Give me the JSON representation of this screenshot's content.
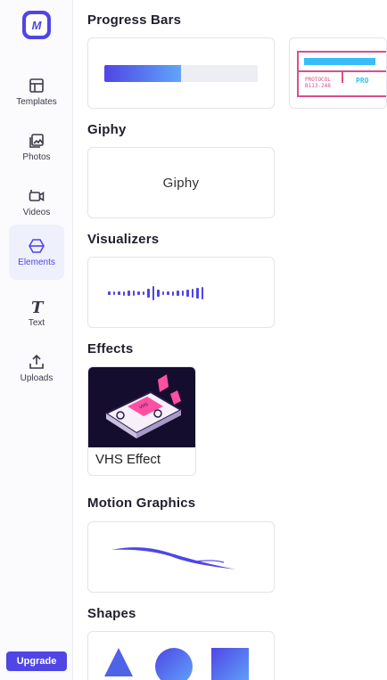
{
  "app": {
    "logo_letter": "M",
    "accent": "#4f46e5"
  },
  "sidebar": {
    "items": [
      {
        "label": "Templates",
        "icon": "templates-icon"
      },
      {
        "label": "Photos",
        "icon": "photos-icon"
      },
      {
        "label": "Videos",
        "icon": "videos-icon"
      },
      {
        "label": "Elements",
        "icon": "elements-icon",
        "active": true
      },
      {
        "label": "Text",
        "icon": "text-icon"
      },
      {
        "label": "Uploads",
        "icon": "uploads-icon"
      }
    ],
    "upgrade_label": "Upgrade"
  },
  "sections": {
    "progress_bars": {
      "title": "Progress Bars",
      "progress_fraction": 0.5,
      "protocol_text_1": "PROTOCOL",
      "protocol_text_2": "B113-248",
      "protocol_right": "PRO"
    },
    "giphy": {
      "title": "Giphy",
      "card_label": "Giphy"
    },
    "visualizers": {
      "title": "Visualizers"
    },
    "effects": {
      "title": "Effects",
      "items": [
        {
          "label": "VHS Effect",
          "thumb_text": "VHS"
        }
      ]
    },
    "motion_graphics": {
      "title": "Motion Graphics"
    },
    "shapes": {
      "title": "Shapes",
      "items": [
        "triangle",
        "circle",
        "square"
      ]
    }
  }
}
